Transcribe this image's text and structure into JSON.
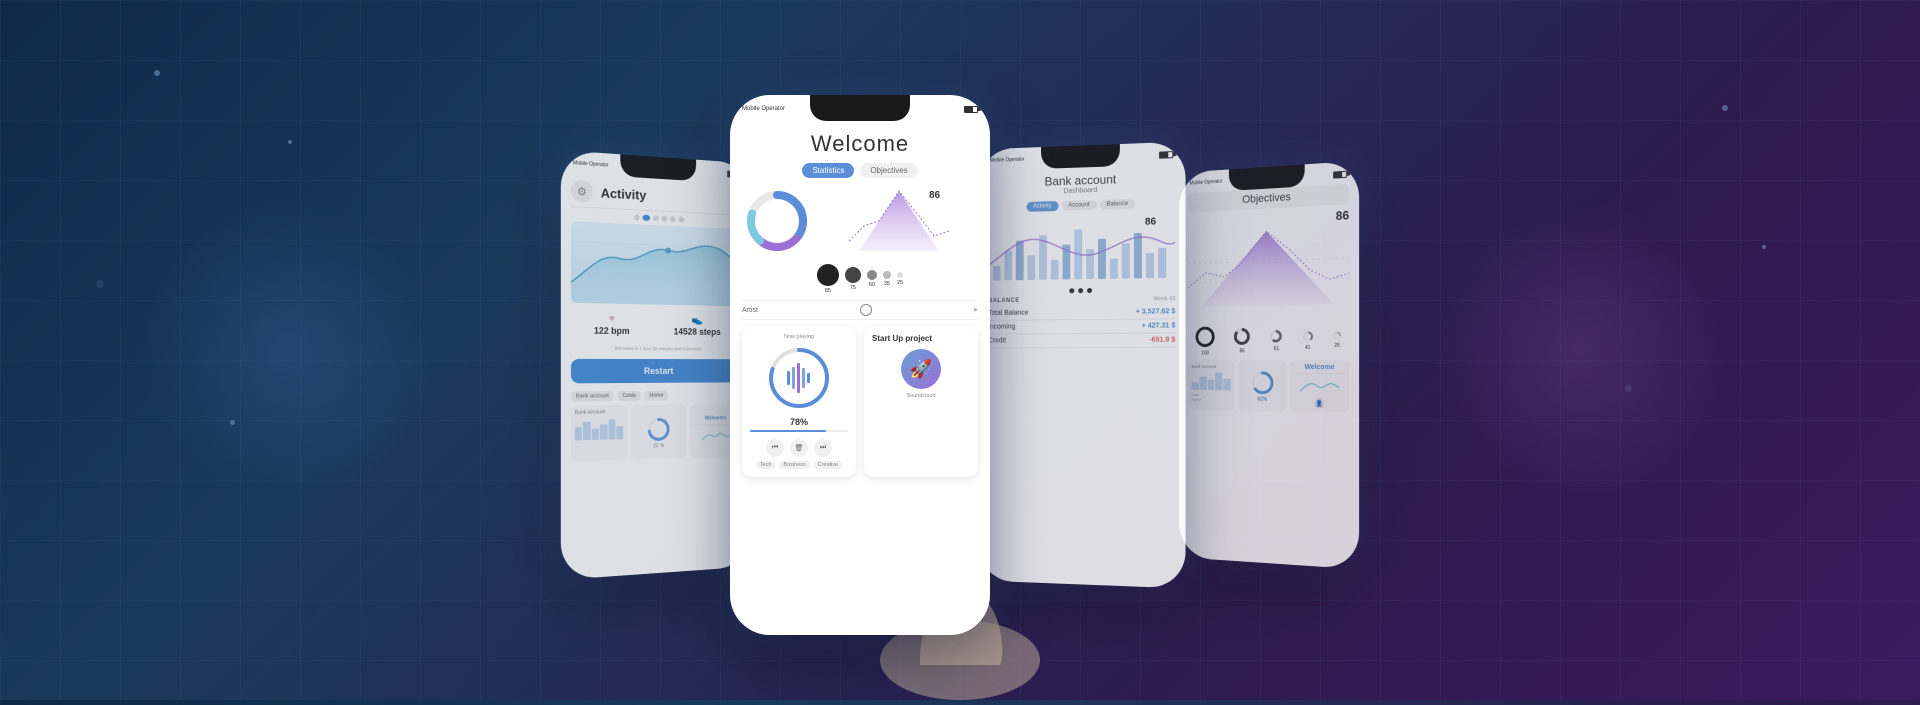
{
  "background": {
    "color_left": "#0d2a4a",
    "color_right": "#3d1a5e"
  },
  "phone1": {
    "title": "Activity",
    "stats": {
      "heart_rate": "122 bpm",
      "steps": "14528 steps",
      "subtitle": "800 Miles in 1 hour 30 minutes and 9 seconds"
    },
    "restart_btn": "Restart",
    "tabs": [
      "Bank account",
      "Colds",
      "Home"
    ],
    "cards": {
      "card1_label": "Bank account",
      "card2_label": "Welcome"
    }
  },
  "phone2": {
    "title": "Welcome",
    "tabs": [
      "Statistics",
      "Objectives"
    ],
    "active_tab": "Statistics",
    "artist_label": "Artist",
    "music_section": {
      "progress_pct": "78%",
      "soundcloud_label": "Soundcloud",
      "genres": [
        "Tech",
        "Business",
        "Creative"
      ]
    },
    "startup": {
      "title": "Start Up project"
    }
  },
  "phone3": {
    "title": "Bank account",
    "subtitle": "Dashboard",
    "tabs": [
      "Activity",
      "Account",
      "Balance"
    ],
    "active_tab": "Activity",
    "balance_num": "86",
    "balance": {
      "label": "BALANCE",
      "week_label": "Week 43",
      "total": "Total Balance",
      "total_value": "+ 3,527.62 $",
      "incoming": "Incoming",
      "incoming_value": "+ 427.31 $",
      "credit": "Credit",
      "credit_value": "-651.9 $"
    }
  },
  "phone4": {
    "title": "Objectives",
    "value": "86",
    "circles": [
      {
        "value": "100"
      },
      {
        "value": "86"
      },
      {
        "value": "61"
      },
      {
        "value": "41"
      },
      {
        "value": "26"
      }
    ],
    "cards": {
      "bank_account": "Bank account",
      "date": "Date",
      "name": "Name"
    },
    "welcome_card": "Welcome"
  }
}
